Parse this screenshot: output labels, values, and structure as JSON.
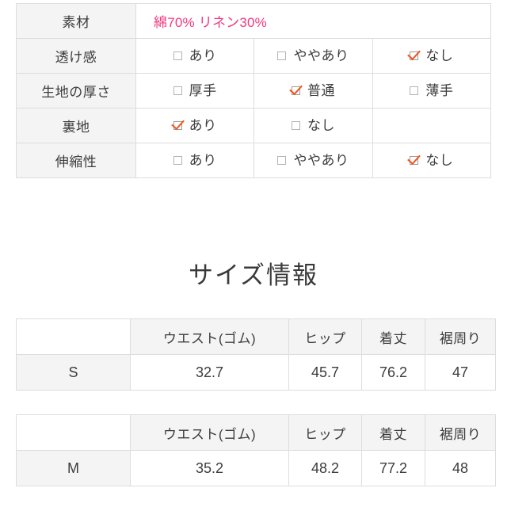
{
  "spec_table": {
    "rows": [
      {
        "label": "素材",
        "type": "text",
        "value": "綿70% リネン30%",
        "value_color": "#f4387e"
      },
      {
        "label": "透け感",
        "type": "options",
        "options": [
          {
            "label": "あり",
            "checked": false
          },
          {
            "label": "ややあり",
            "checked": false
          },
          {
            "label": "なし",
            "checked": true
          }
        ]
      },
      {
        "label": "生地の厚さ",
        "type": "options",
        "options": [
          {
            "label": "厚手",
            "checked": false
          },
          {
            "label": "普通",
            "checked": true
          },
          {
            "label": "薄手",
            "checked": false
          }
        ]
      },
      {
        "label": "裏地",
        "type": "options",
        "options": [
          {
            "label": "あり",
            "checked": true
          },
          {
            "label": "なし",
            "checked": false
          },
          {
            "label": "",
            "checked": false,
            "empty": true
          }
        ]
      },
      {
        "label": "伸縮性",
        "type": "options",
        "options": [
          {
            "label": "あり",
            "checked": false
          },
          {
            "label": "ややあり",
            "checked": false
          },
          {
            "label": "なし",
            "checked": true
          }
        ]
      }
    ]
  },
  "size_section": {
    "title": "サイズ情報",
    "columns": [
      "",
      "ウエスト(ゴム)",
      "ヒップ",
      "着丈",
      "裾周り"
    ],
    "tables": [
      {
        "size": "S",
        "headers": [
          "",
          "ウエスト(ゴム)",
          "ヒップ",
          "着丈",
          "裾周り"
        ],
        "values": [
          "32.7",
          "45.7",
          "76.2",
          "47"
        ]
      },
      {
        "size": "M",
        "headers": [
          "",
          "ウエスト(ゴム)",
          "ヒップ",
          "着丈",
          "裾周り"
        ],
        "values": [
          "35.2",
          "48.2",
          "77.2",
          "48"
        ]
      }
    ]
  },
  "icons": {
    "checked": "checkbox-checked-icon",
    "unchecked": "checkbox-unchecked-icon"
  },
  "colors": {
    "accent_pink": "#f4387e",
    "check_orange": "#f2551d",
    "border": "#dddddd",
    "header_bg": "#f4f4f4",
    "text": "#3c3c3c"
  }
}
